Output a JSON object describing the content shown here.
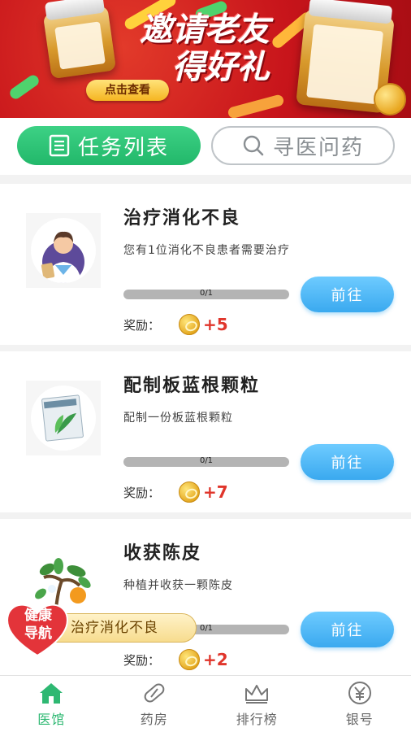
{
  "banner": {
    "title_line1": "邀请老友",
    "title_line2": "得好礼",
    "view_button": "点击查看"
  },
  "tabs": [
    {
      "label": "任务列表",
      "icon": "list-icon",
      "active": true
    },
    {
      "label": "寻医问药",
      "icon": "search-icon",
      "active": false
    }
  ],
  "tasks": [
    {
      "title": "治疗消化不良",
      "description": "您有1位消化不良患者需要治疗",
      "progress_text": "0/1",
      "progress": 0,
      "button": "前往",
      "reward_label": "奖励：",
      "reward_value": "+5",
      "image": "doctor-avatar"
    },
    {
      "title": "配制板蓝根颗粒",
      "description": "配制一份板蓝根颗粒",
      "progress_text": "0/1",
      "progress": 0,
      "button": "前往",
      "reward_label": "奖励：",
      "reward_value": "+7",
      "image": "banlangen-package"
    },
    {
      "title": "收获陈皮",
      "description": "种植并收获一颗陈皮",
      "progress_text": "0/1",
      "progress": 0,
      "button": "前往",
      "reward_label": "奖励：",
      "reward_value": "+2",
      "image": "tangerine-tree"
    }
  ],
  "health_nav": {
    "label": "健康导航",
    "label_line1": "健康",
    "label_line2": "导航",
    "current_task": "治疗消化不良"
  },
  "bottom_nav": [
    {
      "label": "医馆",
      "icon": "home-icon",
      "active": true
    },
    {
      "label": "药房",
      "icon": "pill-icon",
      "active": false
    },
    {
      "label": "排行榜",
      "icon": "crown-icon",
      "active": false
    },
    {
      "label": "银号",
      "icon": "yuan-icon",
      "active": false
    }
  ],
  "colors": {
    "accent_green": "#2eb872",
    "button_blue": "#3aa9ef",
    "reward_red": "#e0352b",
    "banner_red": "#c8151b"
  }
}
